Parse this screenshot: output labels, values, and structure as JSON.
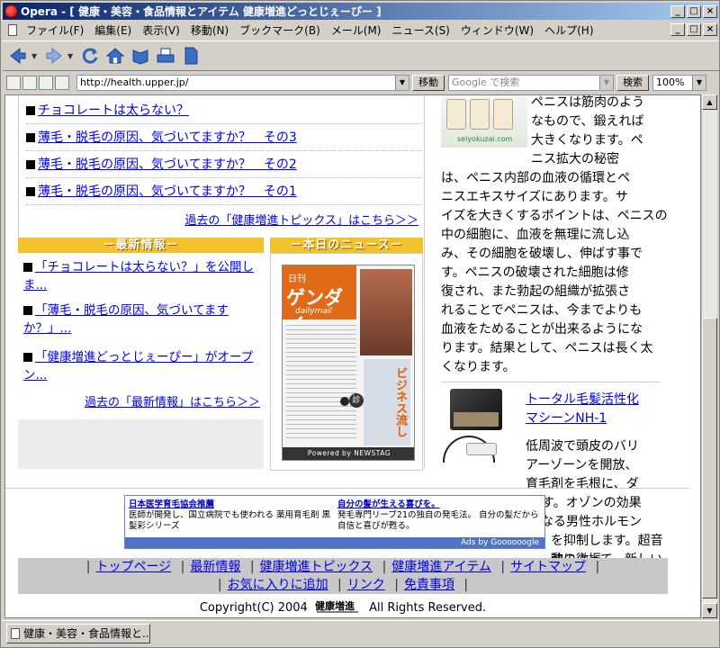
{
  "window": {
    "title": "Opera - [ 健康・美容・食品情報とアイテム 健康増進どっとじぇーぴー ]",
    "controls": [
      "_",
      "□",
      "×"
    ]
  },
  "menu": {
    "items": [
      "ファイル(F)",
      "編集(E)",
      "表示(V)",
      "移動(N)",
      "ブックマーク(B)",
      "メール(M)",
      "ニュース(S)",
      "ウィンドウ(W)",
      "ヘルプ(H)"
    ]
  },
  "toolbar": {
    "icons": [
      "back-arrow-icon",
      "forward-arrow-icon",
      "reload-icon",
      "home-icon",
      "hotlist-icon",
      "print-icon",
      "page-icon"
    ]
  },
  "address": {
    "url": "http://health.upper.jp/",
    "go_label": "移動",
    "search_placeholder": "Google で検索",
    "search_label": "検索",
    "zoom": "100%"
  },
  "topics": {
    "items": [
      "チョコレートは太らない？",
      "薄毛・脱毛の原因、気づいてますか？　その3",
      "薄毛・脱毛の原因、気づいてますか？　その2",
      "薄毛・脱毛の原因、気づいてますか？　その1"
    ],
    "more": "過去の「健康増進トピックス」はこちら＞＞"
  },
  "news": {
    "header": "－最新情報－",
    "items": [
      "「チョコレートは太らない？」を公開しま...",
      "「薄毛・脱毛の原因、気づいてますか？」...",
      "「健康増進どっとじぇーぴー」がオープン..."
    ],
    "more": "過去の「最新情報」はこちら＞＞"
  },
  "today_news": {
    "header": "－本日のニュース－",
    "paper_small": "日刊",
    "paper_title": "ゲンダイ",
    "paper_sub": "dailymail",
    "paper_headline": "ビジネス流し",
    "seal": "診",
    "powered": "Powered by NEWSTAG"
  },
  "product1": {
    "image_url": "selyokuzai.com",
    "text_lines": [
      "ペニスは筋肉のよう",
      "なもので、鍛えれば",
      "大きくなります。ペ",
      "ニス拡大の秘密",
      "は、ペニス内部の血液の循環とペ",
      "ニスエキスサイズにあります。サ",
      "イズを大きくするポイントは、ペニスの",
      "中の細胞に、血液を無理に流し込",
      "み、その細胞を破壊し、伸ばす事で",
      "す。ペニスの破壊された細胞は修",
      "復され、また勃起の組織が拡張さ",
      "れることでペニスは、今までよりも",
      "血液をためることが出来るようにな",
      "ります。結果として、ペニスは長く太",
      "くなります。"
    ]
  },
  "product2": {
    "title_line1": "トータル毛髪活性化",
    "title_line2": "マシーンNH-1",
    "text_lines": [
      "低周波で頭皮のバリ",
      "アーゾーンを開放、",
      "育毛剤を毛根に、ダ",
      "イレクトに伝えます。オゾンの効果",
      "で、脱毛の原因となる男性ホルモン",
      "を抑制します。超音波の微振",
      "動によって、新しい皮膚細"
    ]
  },
  "ads": {
    "ad1_title": "日本医学育毛協会推薦",
    "ad1_body": "医師が開発し、国立病院でも使われる 薬用育毛剤 黒髪彩シリーズ",
    "ad2_title": "自分の髪が生える喜びを。",
    "ad2_body": "発毛専門リーブ21の独自の発毛法。 自分の髪だから自信と喜びが甦る。",
    "by": "Ads by Goooooogle"
  },
  "footer": {
    "row1": [
      "トップページ",
      "最新情報",
      "健康増進トピックス",
      "健康増進アイテム",
      "サイトマップ"
    ],
    "row2": [
      "お気に入りに追加",
      "リンク",
      "免責事項"
    ],
    "copy_left": "Copyright(C) 2004",
    "copy_right": "All Rights Reserved.",
    "logo_text": "健康増進"
  },
  "status": {
    "tab": "健康・美容・食品情報と..."
  }
}
